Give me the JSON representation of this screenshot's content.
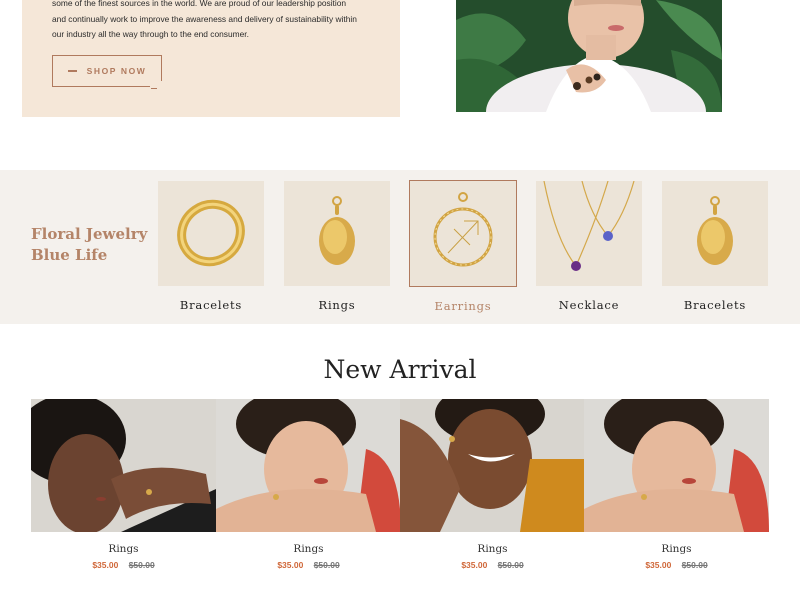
{
  "hero": {
    "lines": [
      "some of the finest sources in the world. We are proud of our leadership position",
      "and continually work to improve the awareness and delivery of sustainability within",
      "our industry all the way through to the end consumer."
    ],
    "button_label": "SHOP NOW"
  },
  "categories": {
    "title_line1": "Floral Jewelry",
    "title_line2": "Blue Life",
    "items": [
      {
        "label": "Bracelets",
        "icon": "gold-band-ring-icon",
        "active": false
      },
      {
        "label": "Rings",
        "icon": "oval-pendant-icon",
        "active": false
      },
      {
        "label": "Earrings",
        "icon": "zodiac-medallion-icon",
        "active": true
      },
      {
        "label": "Necklace",
        "icon": "gem-necklace-icon",
        "active": false
      },
      {
        "label": "Bracelets",
        "icon": "oval-pendant-icon",
        "active": false
      }
    ]
  },
  "new_arrival": {
    "title": "New Arrival",
    "products": [
      {
        "name": "Rings",
        "price": "$35.00",
        "old_price": "$50.00"
      },
      {
        "name": "Rings",
        "price": "$35.00",
        "old_price": "$50.00"
      },
      {
        "name": "Rings",
        "price": "$35.00",
        "old_price": "$50.00"
      },
      {
        "name": "Rings",
        "price": "$35.00",
        "old_price": "$50.00"
      }
    ]
  },
  "colors": {
    "accent": "#b07a5e",
    "hero_bg": "#f5e7d8",
    "band_bg": "#f4f1ed",
    "tile_bg": "#ece4d8",
    "sale_price": "#d0683a"
  }
}
